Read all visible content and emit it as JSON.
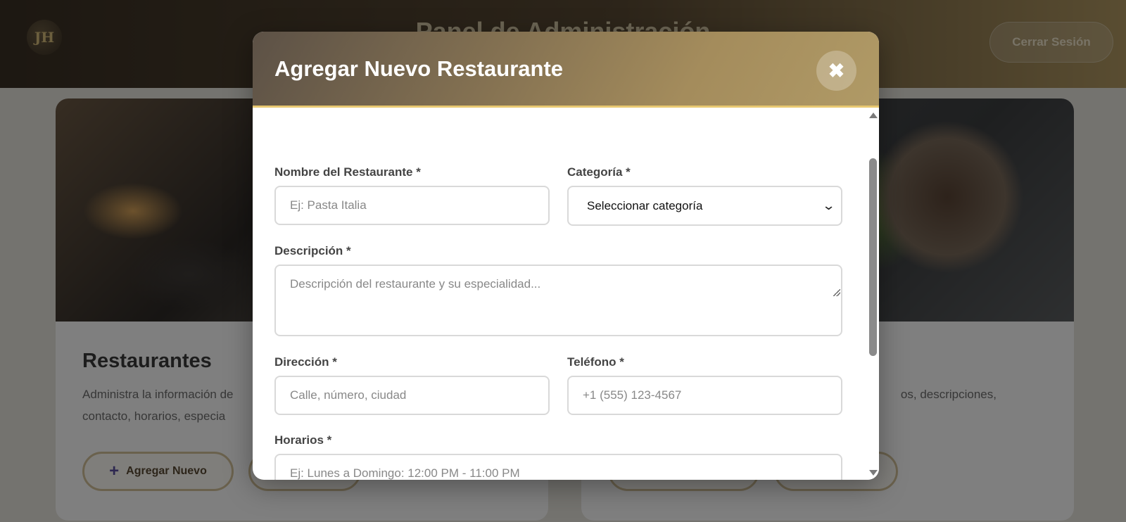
{
  "background": {
    "page_title": "Panel de Administración",
    "logo_text": "JH",
    "logout_label": "Cerrar Sesión",
    "cards": [
      {
        "title": "Restaurantes",
        "description": "Administra la información de",
        "description_line2": "contacto, horarios, especia",
        "primary_button": "Agregar Nuevo",
        "secondary_button": ""
      },
      {
        "title": "",
        "description": "os, descripciones,",
        "primary_button": "",
        "secondary_button": ""
      }
    ]
  },
  "modal": {
    "title": "Agregar Nuevo Restaurante",
    "close_icon": "close-icon",
    "fields": {
      "name": {
        "label": "Nombre del Restaurante *",
        "placeholder": "Ej: Pasta Italia",
        "value": ""
      },
      "category": {
        "label": "Categoría *",
        "selected": "Seleccionar categoría"
      },
      "description": {
        "label": "Descripción *",
        "placeholder": "Descripción del restaurante y su especialidad...",
        "value": ""
      },
      "address": {
        "label": "Dirección *",
        "placeholder": "Calle, número, ciudad",
        "value": ""
      },
      "phone": {
        "label": "Teléfono *",
        "placeholder": "+1 (555) 123-4567",
        "value": ""
      },
      "hours": {
        "label": "Horarios *",
        "placeholder": "Ej: Lunes a Domingo: 12:00 PM - 11:00 PM",
        "value": ""
      }
    }
  },
  "colors": {
    "header_gradient_start": "#5c5146",
    "header_gradient_end": "#b09a66",
    "header_accent": "#e8c871",
    "field_border": "#d9d9d9"
  }
}
